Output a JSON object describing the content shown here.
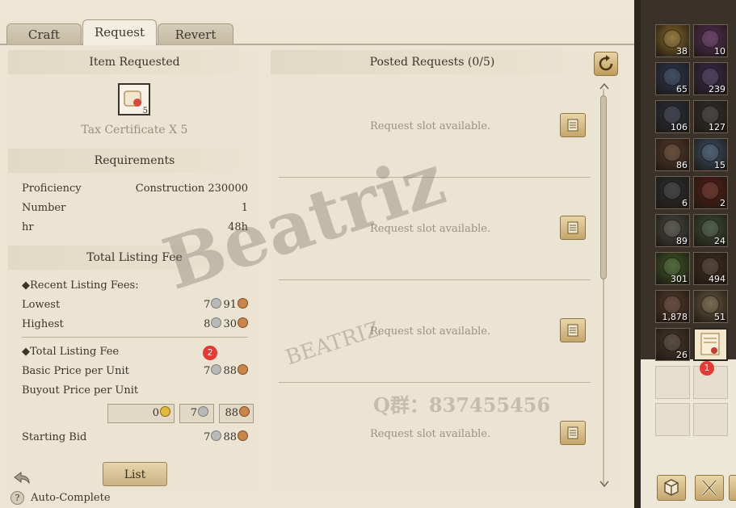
{
  "tabs": [
    {
      "label": "Craft"
    },
    {
      "label": "Request"
    },
    {
      "label": "Revert"
    }
  ],
  "left": {
    "item_requested_title": "Item Requested",
    "item_name": "Tax Certificate X 5",
    "item_count": "5",
    "requirements_title": "Requirements",
    "requirements": [
      {
        "label": "Proficiency",
        "value": "Construction 230000"
      },
      {
        "label": "Number",
        "value": "1"
      },
      {
        "label": "hr",
        "value": "48h"
      }
    ],
    "fee_title": "Total Listing Fee",
    "recent_fees_label": "◆Recent Listing Fees:",
    "lowest_label": "Lowest",
    "lowest_silver": "7",
    "lowest_copper": "91",
    "highest_label": "Highest",
    "highest_silver": "8",
    "highest_copper": "30",
    "total_fee_label": "◆Total Listing Fee",
    "basic_price_label": "Basic Price per Unit",
    "basic_silver": "7",
    "basic_copper": "88",
    "buyout_label": "Buyout Price per Unit",
    "buyout_gold": "0",
    "buyout_silver": "7",
    "buyout_copper": "88",
    "starting_bid_label": "Starting Bid",
    "bid_silver": "7",
    "bid_copper": "88",
    "list_button": "List",
    "auto_complete_label": "Auto-Complete"
  },
  "right": {
    "title": "Posted Requests (0/5)",
    "slot_text": "Request slot available.",
    "watermark_qq": "Q群：837455456"
  },
  "watermark": {
    "main": "Beatriz",
    "sub": "BEATRIZ"
  },
  "inventory": {
    "slots": [
      {
        "count": "38",
        "color": "#8a6a2a",
        "icon": "potion-icon"
      },
      {
        "count": "10",
        "color": "#5a2e5a",
        "icon": "compass-icon"
      },
      {
        "count": "65",
        "color": "#2b3a55",
        "icon": "crystal-icon"
      },
      {
        "count": "239",
        "color": "#3b2a4f",
        "icon": "pouch-icon"
      },
      {
        "count": "106",
        "color": "#2a2f3f",
        "icon": "wand-icon"
      },
      {
        "count": "127",
        "color": "#33312e",
        "icon": "cloth-icon"
      },
      {
        "count": "86",
        "color": "#5a3b28",
        "icon": "book-icon"
      },
      {
        "count": "15",
        "color": "#3c5068",
        "icon": "scroll-icon"
      },
      {
        "count": "6",
        "color": "#2d2f32",
        "icon": "ore-icon"
      },
      {
        "count": "2",
        "color": "#5a1e15",
        "icon": "fire-icon"
      },
      {
        "count": "89",
        "color": "#4a4a44",
        "icon": "coin-icon"
      },
      {
        "count": "24",
        "color": "#3e4f3a",
        "icon": "chest-icon"
      },
      {
        "count": "301",
        "color": "#3f5a25",
        "icon": "herb-icon"
      },
      {
        "count": "494",
        "color": "#40301f",
        "icon": "wood-icon"
      },
      {
        "count": "1,878",
        "color": "#5a3a2a",
        "icon": "shell-icon"
      },
      {
        "count": "51",
        "color": "#6a5a40",
        "icon": "crate-icon"
      },
      {
        "count": "26",
        "color": "#4a3a2a",
        "icon": "bag-icon"
      },
      {
        "count": "",
        "color": "#c69a5a",
        "icon": "tax-certificate-icon"
      }
    ]
  },
  "badges": {
    "inventory_badge": "1",
    "fee_badge": "2"
  }
}
